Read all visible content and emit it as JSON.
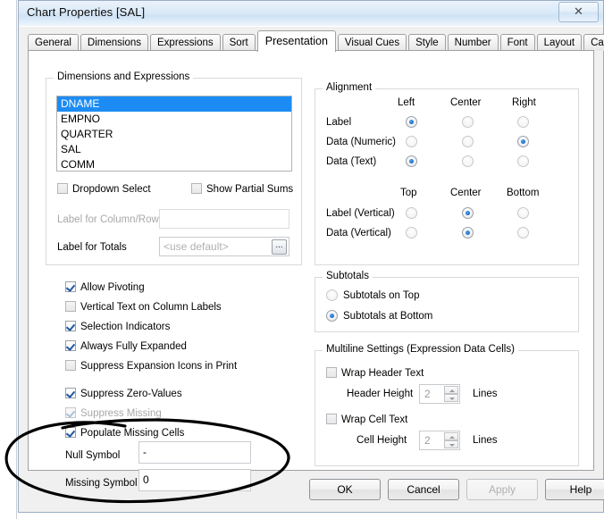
{
  "window": {
    "title": "Chart Properties [SAL]",
    "close_icon": "close-icon",
    "close_glyph": "✕"
  },
  "tabs": [
    {
      "label": "General",
      "active": false
    },
    {
      "label": "Dimensions",
      "active": false
    },
    {
      "label": "Expressions",
      "active": false
    },
    {
      "label": "Sort",
      "active": false
    },
    {
      "label": "Presentation",
      "active": true
    },
    {
      "label": "Visual Cues",
      "active": false
    },
    {
      "label": "Style",
      "active": false
    },
    {
      "label": "Number",
      "active": false
    },
    {
      "label": "Font",
      "active": false
    },
    {
      "label": "Layout",
      "active": false
    },
    {
      "label": "Caption",
      "active": false
    }
  ],
  "dimensions_group": {
    "legend": "Dimensions and Expressions",
    "items": [
      {
        "label": "DNAME",
        "selected": true
      },
      {
        "label": "EMPNO",
        "selected": false
      },
      {
        "label": "QUARTER",
        "selected": false
      },
      {
        "label": "SAL",
        "selected": false
      },
      {
        "label": "COMM",
        "selected": false
      }
    ],
    "dropdown_select": {
      "label": "Dropdown Select",
      "checked": false
    },
    "show_partial_sums": {
      "label": "Show Partial Sums",
      "checked": false
    },
    "label_column_row": {
      "label": "Label for Column/Row",
      "value": "",
      "disabled": true
    },
    "label_totals": {
      "label": "Label for Totals",
      "placeholder": "<use default>",
      "value": "",
      "ellipsis": "..."
    }
  },
  "alignment_group": {
    "legend": "Alignment",
    "h_headers": [
      "Left",
      "Center",
      "Right"
    ],
    "v_headers": [
      "Top",
      "Center",
      "Bottom"
    ],
    "h_rows": [
      {
        "label": "Label",
        "selected": "Left"
      },
      {
        "label": "Data (Numeric)",
        "selected": "Right"
      },
      {
        "label": "Data (Text)",
        "selected": "Left"
      }
    ],
    "v_rows": [
      {
        "label": "Label (Vertical)",
        "selected": "Center"
      },
      {
        "label": "Data (Vertical)",
        "selected": "Center"
      }
    ]
  },
  "options": [
    {
      "label": "Allow Pivoting",
      "checked": true,
      "disabled": false
    },
    {
      "label": "Vertical Text on Column Labels",
      "checked": false,
      "disabled": false
    },
    {
      "label": "Selection Indicators",
      "checked": true,
      "disabled": false
    },
    {
      "label": "Always Fully Expanded",
      "checked": true,
      "disabled": false
    },
    {
      "label": "Suppress Expansion Icons in Print",
      "checked": false,
      "disabled": false
    },
    {
      "label": "Suppress Zero-Values",
      "checked": true,
      "disabled": false
    },
    {
      "label": "Suppress Missing",
      "checked": true,
      "disabled": true
    },
    {
      "label": "Populate Missing Cells",
      "checked": true,
      "disabled": false
    }
  ],
  "symbols": {
    "null_symbol": {
      "label": "Null Symbol",
      "value": "-"
    },
    "missing_symbol": {
      "label": "Missing Symbol",
      "value": "0"
    }
  },
  "subtotals_group": {
    "legend": "Subtotals",
    "options": [
      {
        "label": "Subtotals on Top",
        "selected": false
      },
      {
        "label": "Subtotals at Bottom",
        "selected": true
      }
    ]
  },
  "multiline_group": {
    "legend": "Multiline Settings (Expression Data Cells)",
    "wrap_header": {
      "label": "Wrap Header Text",
      "checked": false
    },
    "header_height": {
      "label": "Header Height",
      "value": "2",
      "unit": "Lines"
    },
    "wrap_cell": {
      "label": "Wrap Cell Text",
      "checked": false
    },
    "cell_height": {
      "label": "Cell Height",
      "value": "2",
      "unit": "Lines"
    }
  },
  "footer": {
    "ok": "OK",
    "cancel": "Cancel",
    "apply": "Apply",
    "help": "Help"
  },
  "annotation": {
    "type": "hand-drawn-ellipse",
    "color": "#000000",
    "description": "circles Null Symbol and Missing Symbol fields"
  }
}
